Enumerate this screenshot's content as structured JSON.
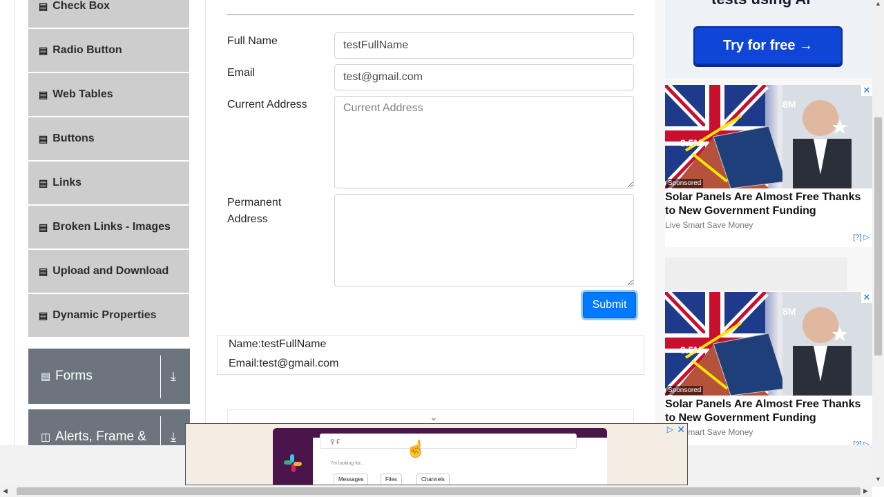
{
  "sidebar": {
    "items": [
      {
        "label": "Check Box",
        "icon": "html-doc-icon"
      },
      {
        "label": "Radio Button",
        "icon": "html-doc-icon"
      },
      {
        "label": "Web Tables",
        "icon": "html-doc-icon"
      },
      {
        "label": "Buttons",
        "icon": "html-doc-icon"
      },
      {
        "label": "Links",
        "icon": "html-doc-icon"
      },
      {
        "label": "Broken Links - Images",
        "icon": "html-doc-icon"
      },
      {
        "label": "Upload and Download",
        "icon": "html-doc-icon"
      },
      {
        "label": "Dynamic Properties",
        "icon": "html-doc-icon"
      }
    ],
    "groups": [
      {
        "label": "Forms",
        "icon": "document-icon"
      },
      {
        "label": "Alerts, Frame &",
        "icon": "window-icon"
      }
    ]
  },
  "form": {
    "full_name": {
      "label": "Full Name",
      "value": "testFullName"
    },
    "email": {
      "label": "Email",
      "value": "test@gmail.com"
    },
    "current_address": {
      "label": "Current Address",
      "placeholder": "Current Address",
      "value": ""
    },
    "permanent_address": {
      "label_line1": "Permanent",
      "label_line2": "Address",
      "value": ""
    },
    "submit_label": "Submit"
  },
  "output": {
    "name": "Name:testFullName",
    "email": "Email:test@gmail.com"
  },
  "ads": {
    "top_heading": "tests using AI",
    "try_button": "Try for free →",
    "cards": [
      {
        "sponsored": "Sponsored",
        "title": "Solar Panels Are Almost Free Thanks to New Government Funding",
        "source": "Live Smart Save Money",
        "label_8m": "8M",
        "label_35m": "3.5M",
        "q": "[?]"
      },
      {
        "sponsored": "Sponsored",
        "title": "Solar Panels Are Almost Free Thanks to New Government Funding",
        "source": "Live Smart Save Money",
        "label_8m": "8M",
        "label_35m": "3.5M",
        "q": "[?]"
      }
    ],
    "bottom": {
      "search_text": "F",
      "hint": "I'm looking for...",
      "pills": [
        "Messages",
        "Files",
        "Channels"
      ]
    }
  },
  "colors": {
    "primary": "#007bff",
    "sidebar_item": "#cdcdcd",
    "group_bg": "#6c757d"
  }
}
